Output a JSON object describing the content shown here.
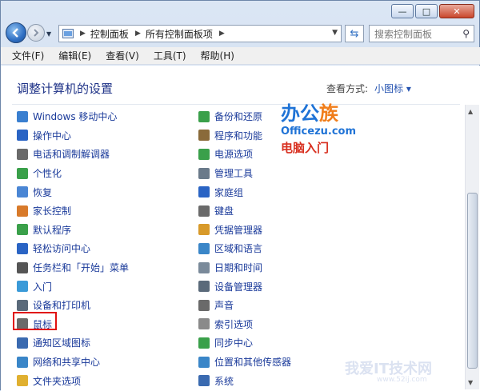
{
  "window": {
    "minimize_glyph": "—",
    "maximize_glyph": "□",
    "close_glyph": "✕"
  },
  "address": {
    "crumbs": [
      "控制面板",
      "所有控制面板项"
    ],
    "search_placeholder": "搜索控制面板"
  },
  "menu": [
    "文件(F)",
    "编辑(E)",
    "查看(V)",
    "工具(T)",
    "帮助(H)"
  ],
  "content": {
    "heading": "调整计算机的设置",
    "view_by_label": "查看方式:",
    "view_by_value": "小图标 ▾"
  },
  "items_left": [
    {
      "label": "Windows 移动中心",
      "icon": "mobility-icon",
      "color": "#3a7fd0"
    },
    {
      "label": "操作中心",
      "icon": "flag-icon",
      "color": "#2a64c4"
    },
    {
      "label": "电话和调制解调器",
      "icon": "phone-icon",
      "color": "#6a6a6a"
    },
    {
      "label": "个性化",
      "icon": "personalize-icon",
      "color": "#3aa04a"
    },
    {
      "label": "恢复",
      "icon": "recovery-icon",
      "color": "#4a86d4"
    },
    {
      "label": "家长控制",
      "icon": "parental-icon",
      "color": "#d87a2a"
    },
    {
      "label": "默认程序",
      "icon": "default-programs-icon",
      "color": "#3aa04a"
    },
    {
      "label": "轻松访问中心",
      "icon": "ease-access-icon",
      "color": "#2a64c4"
    },
    {
      "label": "任务栏和「开始」菜单",
      "icon": "taskbar-icon",
      "color": "#555555"
    },
    {
      "label": "入门",
      "icon": "getting-started-icon",
      "color": "#3a9ad8"
    },
    {
      "label": "设备和打印机",
      "icon": "printer-icon",
      "color": "#5a6a7a"
    },
    {
      "label": "鼠标",
      "icon": "mouse-icon",
      "color": "#6a6a6a"
    },
    {
      "label": "通知区域图标",
      "icon": "notification-icon",
      "color": "#3a6ab0"
    },
    {
      "label": "网络和共享中心",
      "icon": "network-icon",
      "color": "#3a86c8"
    },
    {
      "label": "文件夹选项",
      "icon": "folder-options-icon",
      "color": "#e0b030"
    }
  ],
  "items_right": [
    {
      "label": "备份和还原",
      "icon": "backup-icon",
      "color": "#3aa04a"
    },
    {
      "label": "程序和功能",
      "icon": "programs-icon",
      "color": "#8a6a3a"
    },
    {
      "label": "电源选项",
      "icon": "power-icon",
      "color": "#3aa04a"
    },
    {
      "label": "管理工具",
      "icon": "admin-tools-icon",
      "color": "#6a7a8a"
    },
    {
      "label": "家庭组",
      "icon": "homegroup-icon",
      "color": "#2a64c4"
    },
    {
      "label": "键盘",
      "icon": "keyboard-icon",
      "color": "#6a6a6a"
    },
    {
      "label": "凭据管理器",
      "icon": "credential-icon",
      "color": "#d89a2a"
    },
    {
      "label": "区域和语言",
      "icon": "region-icon",
      "color": "#3a86c8"
    },
    {
      "label": "日期和时间",
      "icon": "clock-icon",
      "color": "#7a8a9a"
    },
    {
      "label": "设备管理器",
      "icon": "device-manager-icon",
      "color": "#5a6a7a"
    },
    {
      "label": "声音",
      "icon": "sound-icon",
      "color": "#6a6a6a"
    },
    {
      "label": "索引选项",
      "icon": "indexing-icon",
      "color": "#8a8a8a"
    },
    {
      "label": "同步中心",
      "icon": "sync-icon",
      "color": "#3aa04a"
    },
    {
      "label": "位置和其他传感器",
      "icon": "sensor-icon",
      "color": "#3a86c8"
    },
    {
      "label": "系统",
      "icon": "system-icon",
      "color": "#3a6ab0"
    }
  ],
  "watermark": {
    "logo_a": "办公",
    "logo_b": "族",
    "url": "Officezu.com",
    "sub": "电脑入门",
    "bottom": "我爱IT技术网",
    "bottom_url": "www.52ij.com"
  }
}
